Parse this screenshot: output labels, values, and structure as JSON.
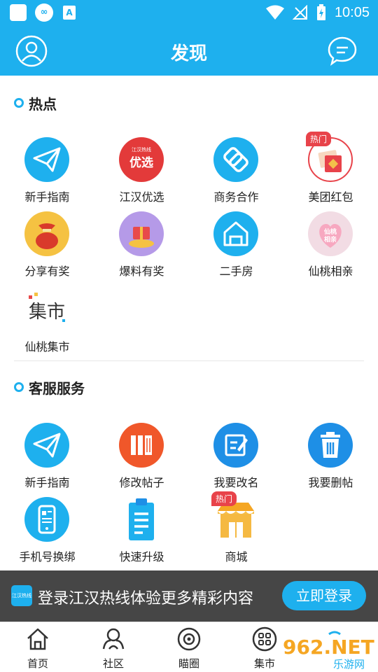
{
  "statusbar": {
    "app_icon_text": "∞",
    "a_icon_text": "A",
    "time": "10:05"
  },
  "header": {
    "title": "发现"
  },
  "hot": {
    "title": "热点",
    "items": [
      {
        "label": "新手指南",
        "icon": "paper-plane-icon"
      },
      {
        "label": "江汉优选",
        "icon": "youxuan-icon",
        "icon_text": "优选",
        "icon_small": "江汉热线"
      },
      {
        "label": "商务合作",
        "icon": "handshake-icon"
      },
      {
        "label": "美团红包",
        "icon": "red-envelope-icon",
        "badge": "热门"
      },
      {
        "label": "分享有奖",
        "icon": "lucky-bag-icon"
      },
      {
        "label": "爆料有奖",
        "icon": "gift-box-icon"
      },
      {
        "label": "二手房",
        "icon": "house-icon"
      },
      {
        "label": "仙桃相亲",
        "icon": "matchmaking-icon",
        "icon_text": "仙桃相亲"
      },
      {
        "label": "仙桃集市",
        "icon": "market-logo-icon",
        "icon_text": "集市"
      }
    ]
  },
  "service": {
    "title": "客服服务",
    "items": [
      {
        "label": "新手指南",
        "icon": "paper-plane-icon"
      },
      {
        "label": "修改帖子",
        "icon": "books-icon"
      },
      {
        "label": "我要改名",
        "icon": "edit-icon"
      },
      {
        "label": "我要删帖",
        "icon": "trash-icon"
      },
      {
        "label": "手机号换绑",
        "icon": "phone-icon"
      },
      {
        "label": "快速升级",
        "icon": "clipboard-icon"
      },
      {
        "label": "商城",
        "icon": "shop-icon",
        "badge": "热门"
      }
    ]
  },
  "banner": {
    "logo_text": "江汉热线",
    "text": "登录江汉热线体验更多精彩内容",
    "button": "立即登录"
  },
  "nav": [
    {
      "label": "首页",
      "icon": "home-icon"
    },
    {
      "label": "社区",
      "icon": "community-icon"
    },
    {
      "label": "瞄圈",
      "icon": "circle-icon"
    },
    {
      "label": "集市",
      "icon": "market-icon"
    }
  ],
  "watermark": {
    "text": "962.NET",
    "sub": "乐游网"
  },
  "colors": {
    "accent": "#1eb0ee",
    "red": "#e8434a"
  }
}
